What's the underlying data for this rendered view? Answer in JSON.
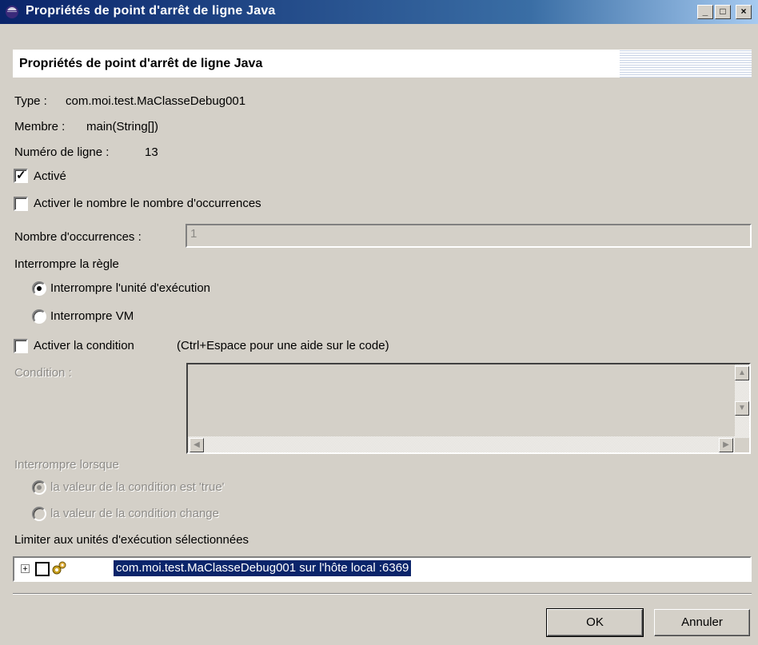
{
  "window": {
    "title": "Propriétés de point d'arrêt de ligne Java",
    "controls": [
      "_",
      "□",
      "×"
    ]
  },
  "header": {
    "title": "Propriétés de point d'arrêt de ligne Java"
  },
  "info": {
    "type_label": "Type :",
    "type_value": "com.moi.test.MaClasseDebug001",
    "member_label": "Membre :",
    "member_value": "main(String[])",
    "line_label": "Numéro de ligne :",
    "line_value": "13"
  },
  "enabled": {
    "label": "Activé",
    "checked": true
  },
  "hitcount_enable": {
    "label": "Activer le nombre le nombre d'occurrences",
    "checked": false
  },
  "hitcount": {
    "label": "Nombre d'occurrences :",
    "value": "1"
  },
  "suspend_policy": {
    "heading": "Interrompre la règle",
    "options": [
      {
        "label": "Interrompre l'unité d'exécution",
        "selected": true
      },
      {
        "label": "Interrompre VM",
        "selected": false
      }
    ]
  },
  "condition_enable": {
    "label": "Activer la condition",
    "hint": "(Ctrl+Espace pour une aide sur le code)",
    "checked": false
  },
  "condition": {
    "label": "Condition :",
    "value": ""
  },
  "suspend_when": {
    "heading": "Interrompre lorsque",
    "options": [
      {
        "label": "la valeur de la condition est 'true'",
        "selected": true
      },
      {
        "label": "la valeur de la condition change",
        "selected": false
      }
    ]
  },
  "threads": {
    "heading": "Limiter aux unités d'exécution sélectionnées",
    "items": [
      {
        "label": "com.moi.test.MaClasseDebug001 sur l'hôte local :6369",
        "checked": false,
        "selected": true
      }
    ]
  },
  "buttons": {
    "ok": "OK",
    "cancel": "Annuler"
  },
  "colors": {
    "titlebar": "#0a246a",
    "selection": "#0a246a",
    "dialog_bg": "#d4d0c8"
  }
}
